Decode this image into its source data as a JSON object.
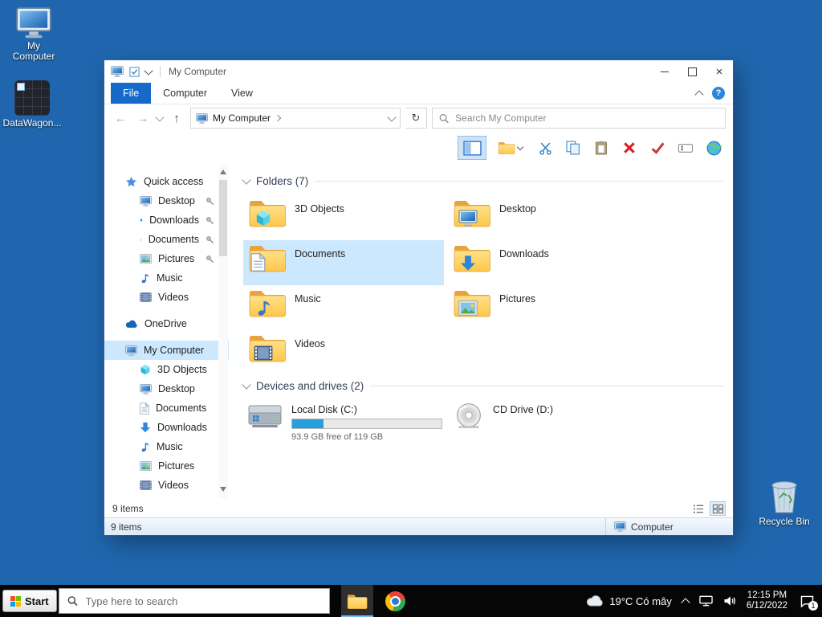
{
  "desktop": {
    "my_computer_label": "My Computer",
    "datawagon_label": "DataWagon...",
    "recycle_label": "Recycle Bin"
  },
  "win": {
    "title": "My Computer",
    "close_glyph": "×",
    "help_glyph": "?",
    "tabs": {
      "file": "File",
      "computer": "Computer",
      "view": "View"
    },
    "nav": {
      "back": "←",
      "forward": "→",
      "up": "↑",
      "refresh": "↻",
      "crumb": "My Computer",
      "search_placeholder": "Search My Computer"
    },
    "side": {
      "quick": {
        "label": "Quick access",
        "items": [
          {
            "label": "Desktop"
          },
          {
            "label": "Downloads"
          },
          {
            "label": "Documents"
          },
          {
            "label": "Pictures"
          },
          {
            "label": "Music"
          },
          {
            "label": "Videos"
          }
        ]
      },
      "onedrive": "OneDrive",
      "pc": {
        "label": "My Computer",
        "items": [
          {
            "label": "3D Objects"
          },
          {
            "label": "Desktop"
          },
          {
            "label": "Documents"
          },
          {
            "label": "Downloads"
          },
          {
            "label": "Music"
          },
          {
            "label": "Pictures"
          },
          {
            "label": "Videos"
          }
        ]
      }
    },
    "groups": {
      "folders": "Folders (7)",
      "drives": "Devices and drives (2)"
    },
    "folders": [
      "3D Objects",
      "Documents",
      "Music",
      "Videos",
      "Desktop",
      "Downloads",
      "Pictures"
    ],
    "drives": [
      {
        "label": "Local Disk (C:)",
        "free": "93.9 GB free of 119 GB",
        "used_pct": 21
      },
      {
        "label": "CD Drive (D:)"
      }
    ],
    "status": {
      "count": "9 items"
    },
    "bottom": {
      "count": "9 items",
      "zone": "Computer"
    }
  },
  "taskbar": {
    "start": "Start",
    "search_placeholder": "Type here to search",
    "weather": "19°C Có mây",
    "time": "12:15 PM",
    "date": "6/12/2022",
    "badge": "1"
  }
}
